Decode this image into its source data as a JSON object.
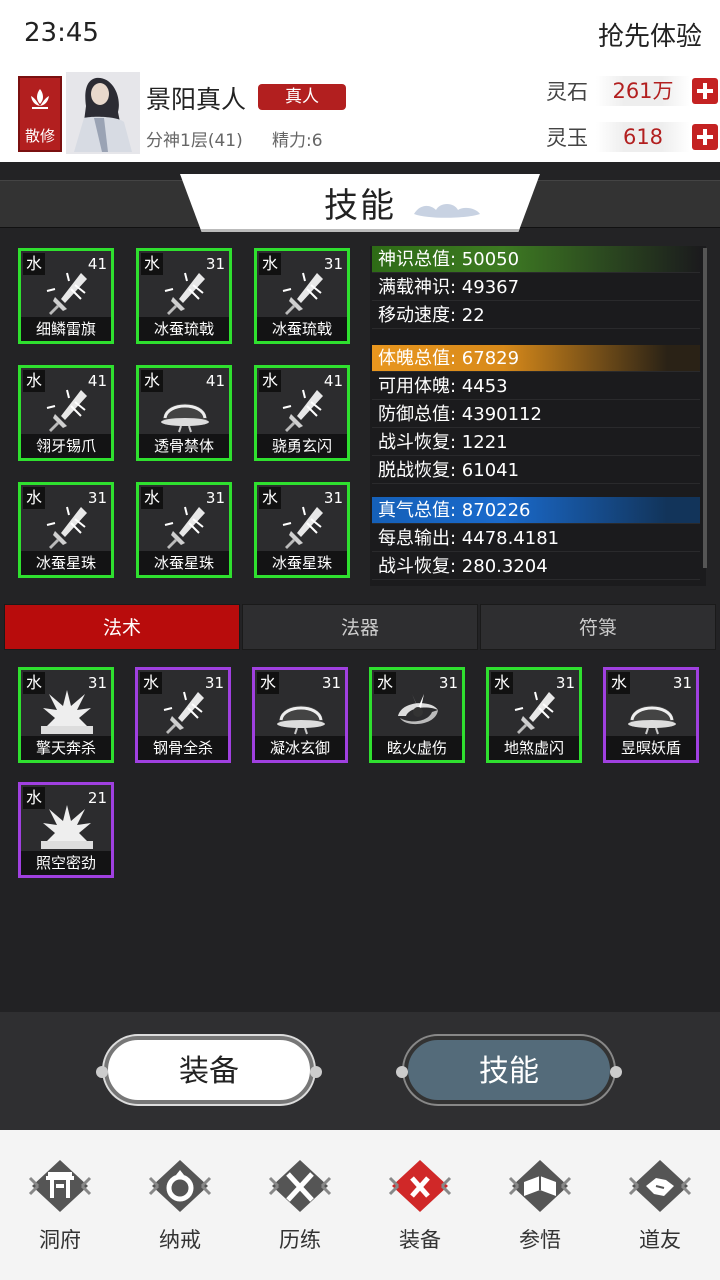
{
  "status": {
    "time": "23:45",
    "trial": "抢先体验"
  },
  "player": {
    "sect": "散修",
    "name": "景阳真人",
    "rank": "真人",
    "realm": "分神1层(41)",
    "energy": "精力:6"
  },
  "currency": [
    {
      "label": "灵石",
      "value": "261万"
    },
    {
      "label": "灵玉",
      "value": "618"
    }
  ],
  "title": "技能",
  "equipped": [
    {
      "element": "水",
      "level": "41",
      "name": "细鳞雷旗",
      "icon": "sword-icon",
      "rarity": "green"
    },
    {
      "element": "水",
      "level": "31",
      "name": "冰蚕琉戟",
      "icon": "sword-icon",
      "rarity": "green"
    },
    {
      "element": "水",
      "level": "31",
      "name": "冰蚕琉戟",
      "icon": "sword-icon",
      "rarity": "green"
    },
    {
      "element": "水",
      "level": "41",
      "name": "翎牙锡爪",
      "icon": "sword-icon",
      "rarity": "green"
    },
    {
      "element": "水",
      "level": "41",
      "name": "透骨禁体",
      "icon": "shield-dome-icon",
      "rarity": "green"
    },
    {
      "element": "水",
      "level": "41",
      "name": "骁勇玄闪",
      "icon": "sword-icon",
      "rarity": "green"
    },
    {
      "element": "水",
      "level": "31",
      "name": "冰蚕星珠",
      "icon": "sword-icon",
      "rarity": "green"
    },
    {
      "element": "水",
      "level": "31",
      "name": "冰蚕星珠",
      "icon": "sword-icon",
      "rarity": "green"
    },
    {
      "element": "水",
      "level": "31",
      "name": "冰蚕星珠",
      "icon": "sword-icon",
      "rarity": "green"
    }
  ],
  "stats": [
    {
      "text": "神识总值: 50050",
      "style": "head-green"
    },
    {
      "text": "满载神识: 49367",
      "style": ""
    },
    {
      "text": "移动速度: 22",
      "style": ""
    },
    {
      "text": "体魄总值: 67829",
      "style": "head-orange"
    },
    {
      "text": "可用体魄: 4453",
      "style": ""
    },
    {
      "text": "防御总值: 4390112",
      "style": ""
    },
    {
      "text": "战斗恢复: 1221",
      "style": ""
    },
    {
      "text": "脱战恢复: 61041",
      "style": ""
    },
    {
      "text": "真气总值: 870226",
      "style": "head-blue"
    },
    {
      "text": "每息输出: 4478.4181",
      "style": ""
    },
    {
      "text": "战斗恢复: 280.3204",
      "style": ""
    }
  ],
  "tabs": [
    {
      "label": "法术",
      "active": true
    },
    {
      "label": "法器",
      "active": false
    },
    {
      "label": "符箓",
      "active": false
    }
  ],
  "inventory": [
    {
      "element": "水",
      "level": "31",
      "name": "擎天奔杀",
      "icon": "burst-icon",
      "rarity": "green"
    },
    {
      "element": "水",
      "level": "31",
      "name": "钢骨全杀",
      "icon": "sword-icon",
      "rarity": "purple"
    },
    {
      "element": "水",
      "level": "31",
      "name": "凝冰玄御",
      "icon": "shield-dome-icon",
      "rarity": "purple"
    },
    {
      "element": "水",
      "level": "31",
      "name": "眩火虚伤",
      "icon": "vortex-icon",
      "rarity": "green"
    },
    {
      "element": "水",
      "level": "31",
      "name": "地煞虚闪",
      "icon": "sword-icon",
      "rarity": "green"
    },
    {
      "element": "水",
      "level": "31",
      "name": "昱暝妖盾",
      "icon": "shield-dome-icon",
      "rarity": "purple"
    },
    {
      "element": "水",
      "level": "21",
      "name": "照空密劲",
      "icon": "burst-icon",
      "rarity": "purple"
    }
  ],
  "buttons": {
    "equip": "装备",
    "skill": "技能"
  },
  "nav": [
    {
      "label": "洞府",
      "icon": "gate-icon",
      "active": false
    },
    {
      "label": "纳戒",
      "icon": "ring-icon",
      "active": false
    },
    {
      "label": "历练",
      "icon": "crossed-swords-icon",
      "active": false
    },
    {
      "label": "装备",
      "icon": "close-icon",
      "active": true
    },
    {
      "label": "参悟",
      "icon": "book-icon",
      "active": false
    },
    {
      "label": "道友",
      "icon": "handshake-icon",
      "active": false
    }
  ]
}
